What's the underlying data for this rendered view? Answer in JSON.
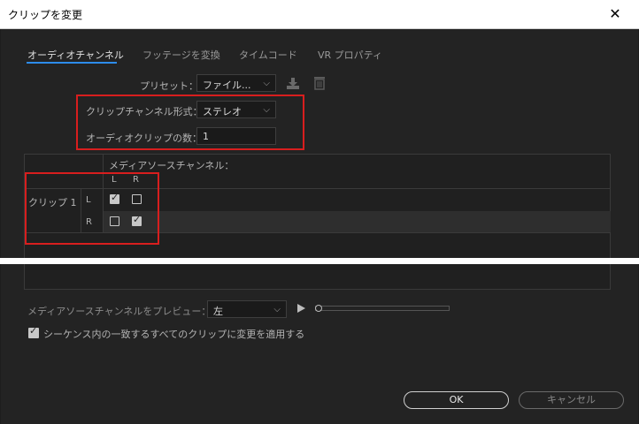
{
  "window": {
    "title": "クリップを変更",
    "close_icon": "close-icon"
  },
  "tabs": [
    {
      "label": "オーディオチャンネル",
      "active": true
    },
    {
      "label": "フッテージを変換",
      "active": false
    },
    {
      "label": "タイムコード",
      "active": false
    },
    {
      "label": "VR プロパティ",
      "active": false
    }
  ],
  "preset": {
    "label": "プリセット：",
    "value": "ファイル..."
  },
  "format": {
    "label": "クリップチャンネル形式：",
    "value": "ステレオ"
  },
  "audio_clips": {
    "label": "オーディオクリップの数：",
    "value": "1"
  },
  "matrix": {
    "source_header": "メディアソースチャンネル：",
    "columns": [
      "L",
      "R"
    ],
    "clip_label": "クリップ 1",
    "rows": [
      {
        "label": "L",
        "checks": [
          true,
          false
        ]
      },
      {
        "label": "R",
        "checks": [
          false,
          true
        ]
      }
    ]
  },
  "preview": {
    "label": "メディアソースチャンネルをプレビュー：",
    "value": "左"
  },
  "apply_all": {
    "label": "シーケンス内の一致するすべてのクリップに変更を適用する",
    "checked": true
  },
  "buttons": {
    "ok": "OK",
    "cancel": "キャンセル"
  },
  "colors": {
    "accent": "#2d8ceb",
    "highlight_box": "#d81e1e",
    "background": "#232323"
  }
}
